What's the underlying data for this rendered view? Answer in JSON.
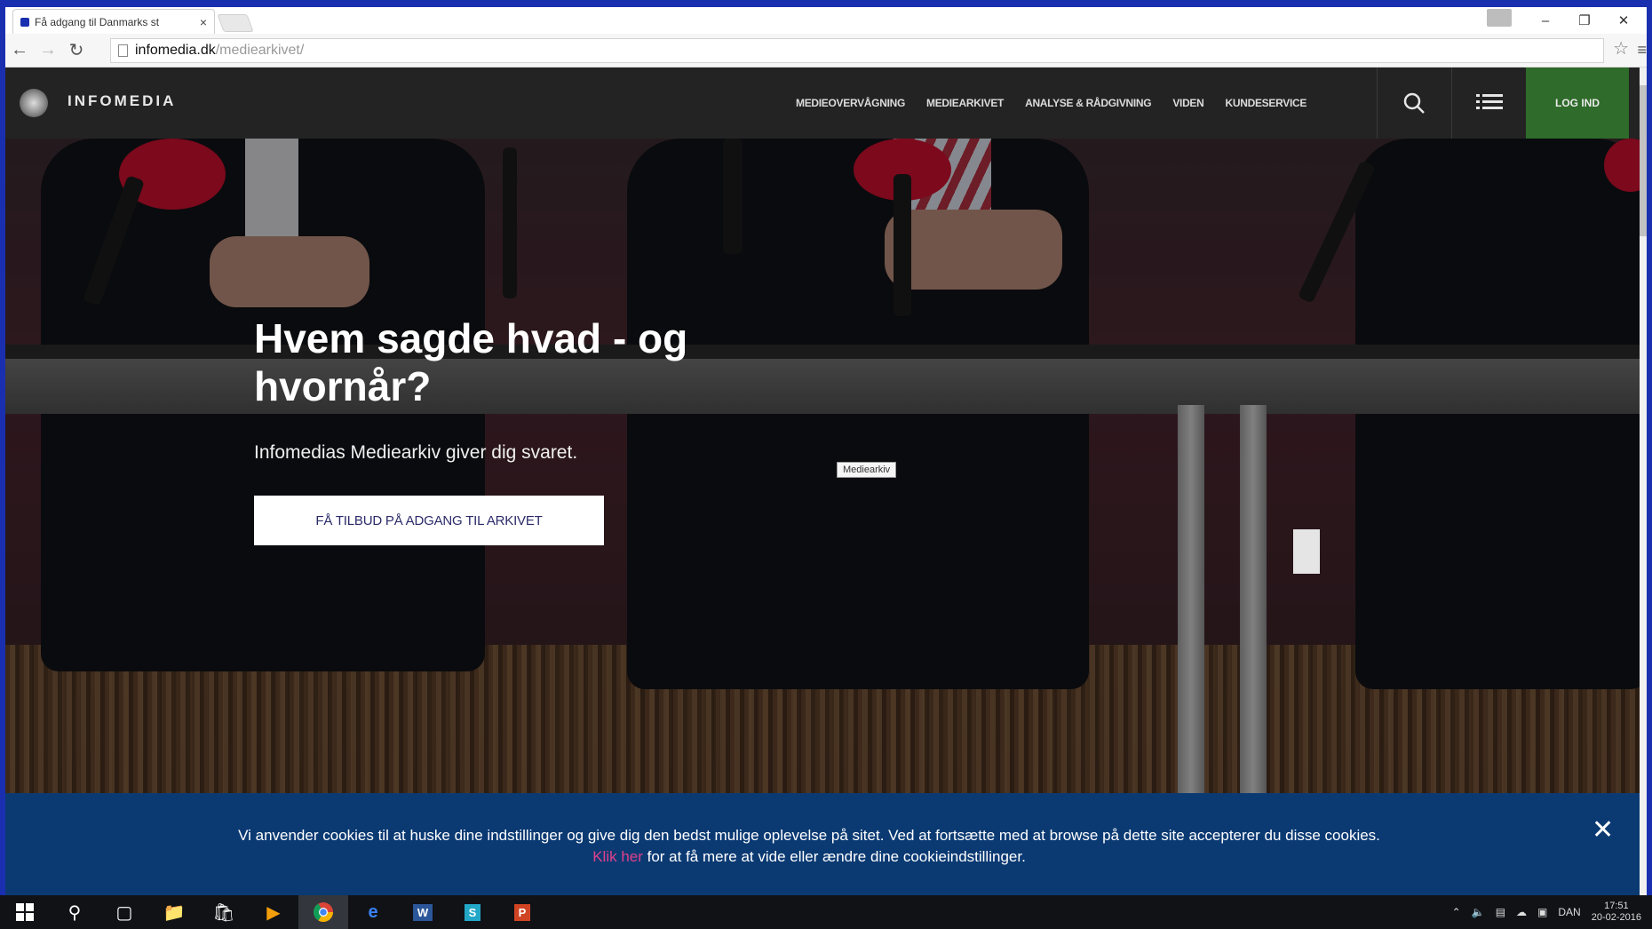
{
  "browser": {
    "tab_title": "Få adgang til Danmarks st",
    "tab_close": "×",
    "url_domain": "infomedia.dk",
    "url_path": "/mediearkivet/",
    "star": "☆",
    "menu": "≡"
  },
  "window": {
    "minimize": "–",
    "restore": "❐",
    "close": "✕"
  },
  "site": {
    "logo_text": "INFOMEDIA",
    "nav": [
      "MEDIEOVERVÅGNING",
      "MEDIEARKIVET",
      "ANALYSE & RÅDGIVNING",
      "VIDEN",
      "KUNDESERVICE"
    ],
    "login_label": "LOG IND"
  },
  "hero": {
    "headline": "Hvem sagde hvad - og hvornår?",
    "subline": "Infomedias Mediearkiv giver dig svaret.",
    "cta_label": "FÅ TILBUD PÅ ADGANG TIL ARKIVET",
    "tooltip": "Mediearkiv"
  },
  "cookie": {
    "text_before": "Vi anvender cookies til at huske dine indstillinger og give dig den bedst mulige oplevelse på sitet. Ved at fortsætte med at browse på dette site accepterer du disse cookies.",
    "link_text": "Klik her",
    "text_after": "for at få mere at vide eller ændre dine cookieindstillinger.",
    "close": "✕"
  },
  "taskbar": {
    "language": "DAN",
    "time": "17:51",
    "date": "20-02-2016"
  },
  "colors": {
    "header_bg": "#232323",
    "login_bg": "#2f6b2a",
    "cookie_bg": "#0b3a73",
    "link_pink": "#e0408c"
  }
}
